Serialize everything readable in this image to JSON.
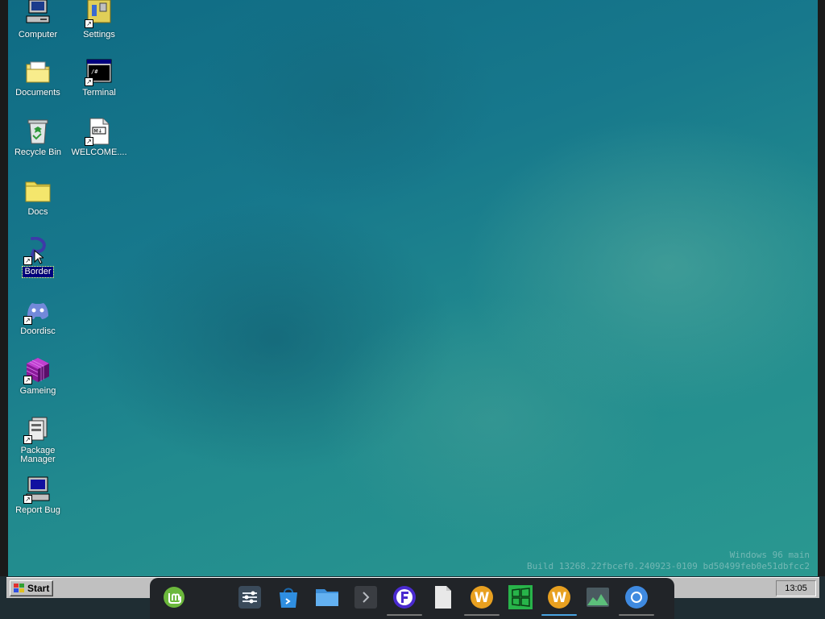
{
  "desktop": {
    "icons": [
      {
        "label": "Computer"
      },
      {
        "label": "Settings"
      },
      {
        "label": "Documents"
      },
      {
        "label": "Terminal"
      },
      {
        "label": "Recycle Bin"
      },
      {
        "label": "WELCOME...."
      },
      {
        "label": "Docs"
      },
      {
        "label": "Border"
      },
      {
        "label": "Doordisc"
      },
      {
        "label": "Gameing"
      },
      {
        "label": "Package Manager"
      },
      {
        "label": "Report Bug"
      }
    ],
    "selected_icon": "Border",
    "build_watermark": {
      "line1": "Windows 96 main",
      "line2": "Build 13268.22fbcef0.240923-0109 bd50499feb0e51dbfcc2"
    }
  },
  "taskbar": {
    "start_label": "Start",
    "clock": "13:05"
  },
  "dock": {
    "items": [
      {
        "name": "linux-mint-menu"
      },
      {
        "name": "system-settings"
      },
      {
        "name": "software-store"
      },
      {
        "name": "file-manager"
      },
      {
        "name": "terminal"
      },
      {
        "name": "app-f"
      },
      {
        "name": "text-editor"
      },
      {
        "name": "app-w"
      },
      {
        "name": "windows-app"
      },
      {
        "name": "app-w"
      },
      {
        "name": "system-monitor"
      },
      {
        "name": "chromium-browser"
      }
    ]
  },
  "colors": {
    "desktop_bg": "#1d7f8c",
    "taskbar": "#c0c0c0",
    "dock": "#212428",
    "selection": "#000080",
    "active_indicator": "#4aa3e0"
  }
}
